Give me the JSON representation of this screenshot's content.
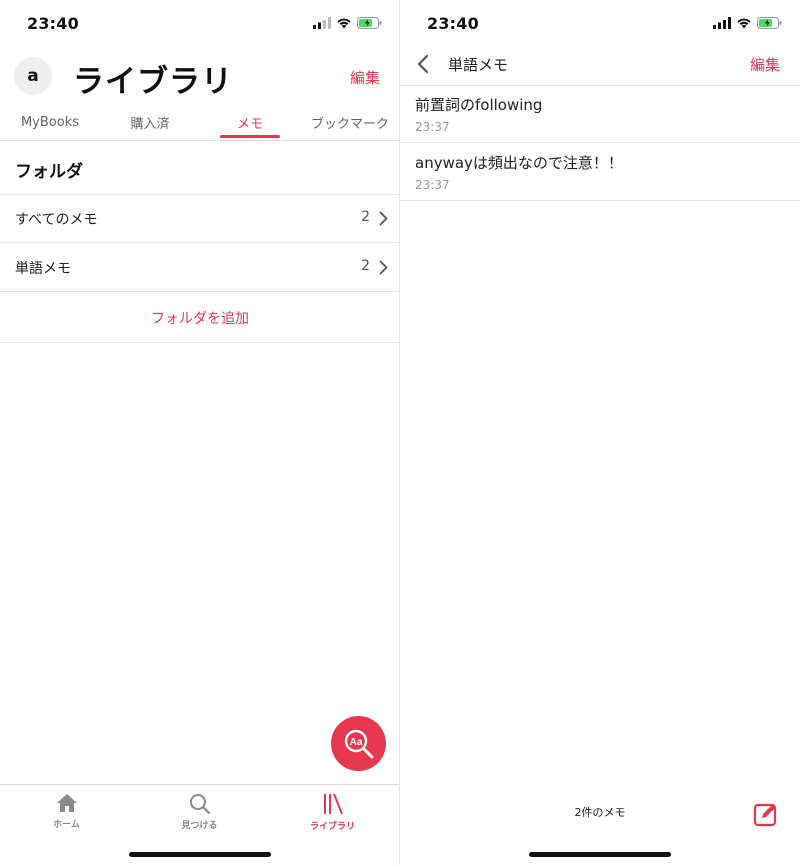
{
  "left": {
    "status": {
      "time": "23:40"
    },
    "avatar_letter": "a",
    "title": "ライブラリ",
    "edit_label": "編集",
    "tabs": [
      {
        "label": "MyBooks"
      },
      {
        "label": "購入済"
      },
      {
        "label": "メモ",
        "active": true
      },
      {
        "label": "ブックマーク"
      }
    ],
    "folder_header": "フォルダ",
    "folders": [
      {
        "label": "すべてのメモ",
        "count": "2"
      },
      {
        "label": "単語メモ",
        "count": "2"
      }
    ],
    "add_folder_label": "フォルダを追加",
    "fab_icon": "dictionary-search-icon",
    "tabbar": [
      {
        "label": "ホーム",
        "icon": "home-icon"
      },
      {
        "label": "見つける",
        "icon": "search-icon"
      },
      {
        "label": "ライブラリ",
        "icon": "library-icon",
        "active": true
      }
    ]
  },
  "right": {
    "status": {
      "time": "23:40"
    },
    "nav_title": "単語メモ",
    "edit_label": "編集",
    "memos": [
      {
        "text": "前置詞のfollowing",
        "time": "23:37"
      },
      {
        "text": "anywayは頻出なので注意！！",
        "time": "23:37"
      }
    ],
    "memo_count": "2件のメモ",
    "compose_icon": "compose-icon"
  },
  "colors": {
    "accent": "#e8384f",
    "battery": "#4cd964",
    "divider": "#e6e6e6"
  }
}
